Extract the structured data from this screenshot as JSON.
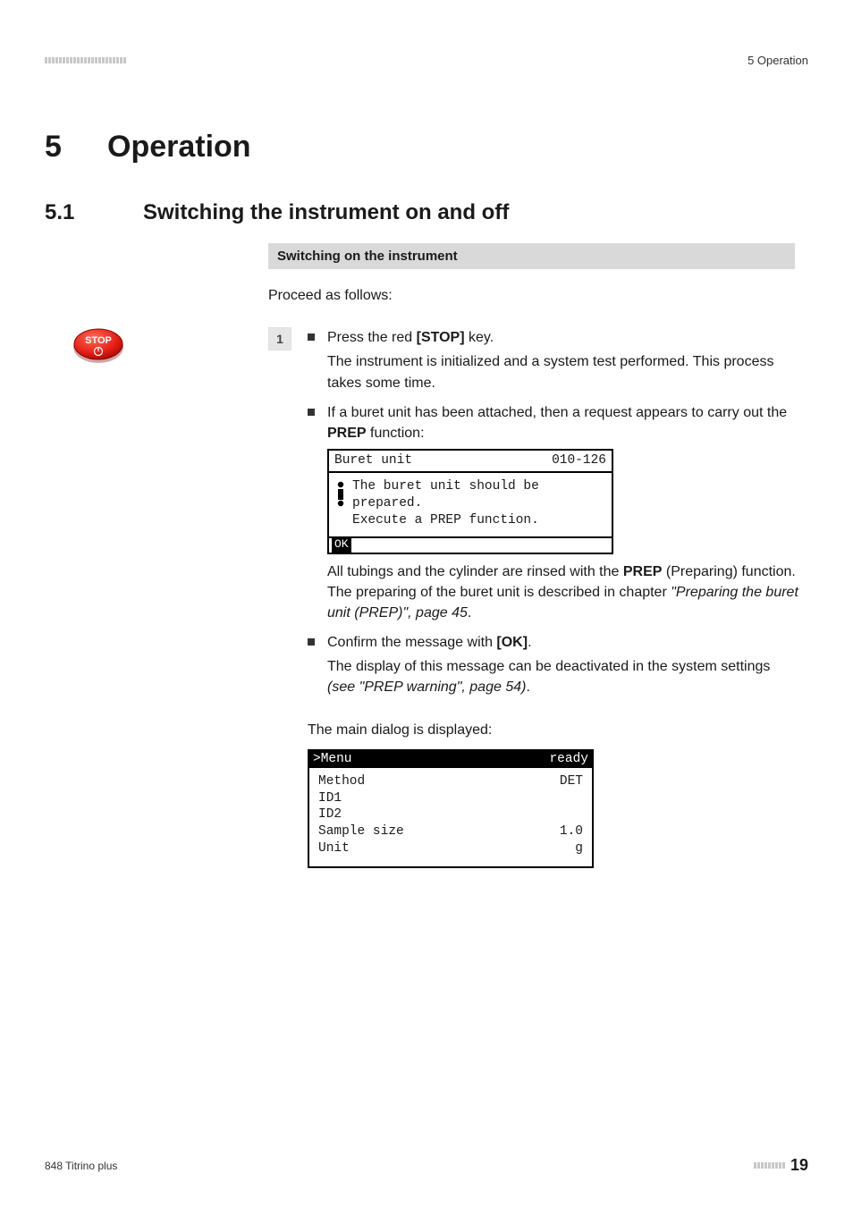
{
  "header": {
    "right": "5 Operation"
  },
  "chapter": {
    "number": "5",
    "title": "Operation"
  },
  "section": {
    "number": "5.1",
    "title": "Switching the instrument on and off"
  },
  "subheading": "Switching on the instrument",
  "intro": "Proceed as follows:",
  "stop_icon_label": "STOP",
  "step": {
    "number": "1",
    "bullet1": {
      "lead": "Press the red ",
      "bold": "[STOP]",
      "tail": " key."
    },
    "after_bullet1": "The instrument is initialized and a system test performed. This process takes some time.",
    "bullet2": {
      "lead": "If a buret unit has been attached, then a request appears to carry out the ",
      "bold": "PREP",
      "tail": " function:"
    },
    "lcd1": {
      "top_left": "Buret unit",
      "top_right": "010-126",
      "line1": "The buret unit should be",
      "line2": "prepared.",
      "line3": "Execute a PREP function.",
      "ok": "OK"
    },
    "after_lcd1": {
      "p1a": "All tubings and the cylinder are rinsed with the ",
      "p1b": "PREP",
      "p1c": " (Preparing) function. The preparing of the buret unit is described in chapter ",
      "p1d": "\"Preparing the buret unit (PREP)\", page 45",
      "p1e": "."
    },
    "bullet3": {
      "lead": "Confirm the message with ",
      "bold": "[OK]",
      "tail": "."
    },
    "after_bullet3": {
      "a": "The display of this message can be deactivated in the system settings ",
      "b": "(see \"PREP warning\", page 54)",
      "c": "."
    }
  },
  "intermission": "The main dialog is displayed:",
  "lcd2": {
    "top_left": ">Menu",
    "top_right": "ready",
    "rows": [
      {
        "l": "Method",
        "r": "DET"
      },
      {
        "l": "ID1",
        "r": ""
      },
      {
        "l": "ID2",
        "r": ""
      },
      {
        "l": "Sample size",
        "r": "1.0"
      },
      {
        "l": "Unit",
        "r": "g"
      }
    ]
  },
  "footer": {
    "left": "848 Titrino plus",
    "page": "19"
  }
}
